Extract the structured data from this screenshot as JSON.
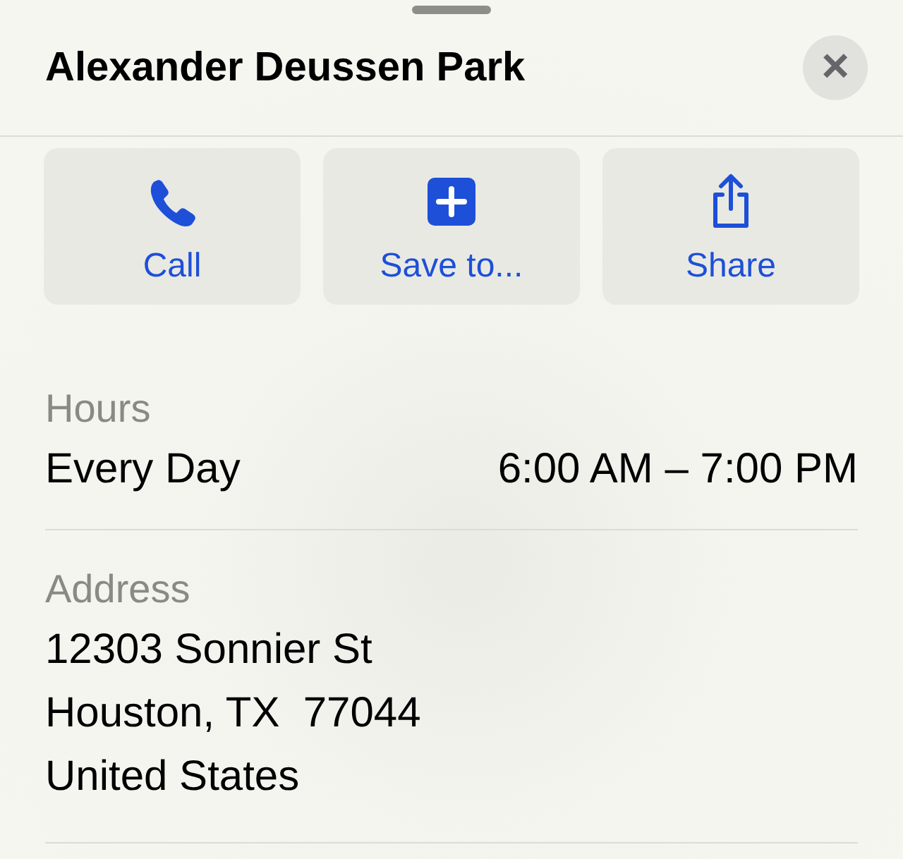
{
  "sheet": {
    "title": "Alexander Deussen Park",
    "close": "×"
  },
  "actions": [
    {
      "kind": "call",
      "label": "Call"
    },
    {
      "kind": "save",
      "label": "Save to..."
    },
    {
      "kind": "share",
      "label": "Share"
    }
  ],
  "hours": {
    "label": "Hours",
    "days": "Every Day",
    "time": "6:00 AM – 7:00 PM"
  },
  "address": {
    "label": "Address",
    "lines": [
      "12303 Sonnier St",
      "Houston, TX  77044",
      "United States"
    ]
  }
}
